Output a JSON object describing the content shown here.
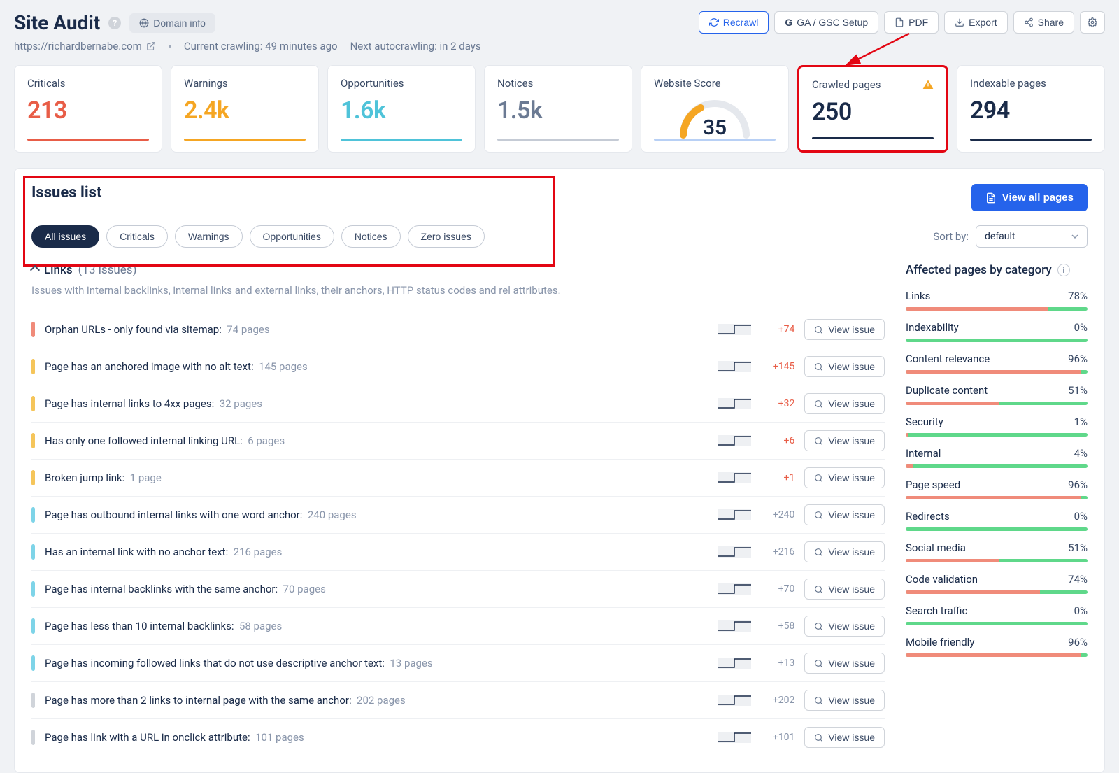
{
  "page_title": "Site Audit",
  "domain_info_btn": "Domain info",
  "header_buttons": {
    "recrawl": "Recrawl",
    "ga_gsc": "GA / GSC Setup",
    "pdf": "PDF",
    "export": "Export",
    "share": "Share"
  },
  "subheader": {
    "url": "https://richardbernabe.com",
    "crawl_status": "Current crawling: 49 minutes ago",
    "autocrawl": "Next autocrawling: in 2 days"
  },
  "stats": {
    "criticals": {
      "label": "Criticals",
      "value": "213"
    },
    "warnings": {
      "label": "Warnings",
      "value": "2.4k"
    },
    "opportunities": {
      "label": "Opportunities",
      "value": "1.6k"
    },
    "notices": {
      "label": "Notices",
      "value": "1.5k"
    },
    "website_score": {
      "label": "Website Score",
      "value": "35"
    },
    "crawled": {
      "label": "Crawled pages",
      "value": "250"
    },
    "indexable": {
      "label": "Indexable pages",
      "value": "294"
    }
  },
  "issues_title": "Issues list",
  "view_all_pages": "View all pages",
  "filters": [
    "All issues",
    "Criticals",
    "Warnings",
    "Opportunities",
    "Notices",
    "Zero issues"
  ],
  "sort_label": "Sort by:",
  "sort_value": "default",
  "section": {
    "name": "Links",
    "count": "(13 issues)",
    "desc": "Issues with internal backlinks, internal links and external links, their anchors, HTTP status codes and rel attributes."
  },
  "view_issue_label": "View issue",
  "issues": [
    {
      "sev": "critical",
      "name": "Orphan URLs - only found via sitemap:",
      "pages": "74 pages",
      "delta": "+74",
      "dcolor": "red"
    },
    {
      "sev": "warning",
      "name": "Page has an anchored image with no alt text:",
      "pages": "145 pages",
      "delta": "+145",
      "dcolor": "red"
    },
    {
      "sev": "warning",
      "name": "Page has internal links to 4xx pages:",
      "pages": "32 pages",
      "delta": "+32",
      "dcolor": "red"
    },
    {
      "sev": "warning",
      "name": "Has only one followed internal linking URL:",
      "pages": "6 pages",
      "delta": "+6",
      "dcolor": "red"
    },
    {
      "sev": "warning",
      "name": "Broken jump link:",
      "pages": "1 page",
      "delta": "+1",
      "dcolor": "red"
    },
    {
      "sev": "opportunity",
      "name": "Page has outbound internal links with one word anchor:",
      "pages": "240 pages",
      "delta": "+240",
      "dcolor": "gray"
    },
    {
      "sev": "opportunity",
      "name": "Has an internal link with no anchor text:",
      "pages": "216 pages",
      "delta": "+216",
      "dcolor": "gray"
    },
    {
      "sev": "opportunity",
      "name": "Page has internal backlinks with the same anchor:",
      "pages": "70 pages",
      "delta": "+70",
      "dcolor": "gray"
    },
    {
      "sev": "opportunity",
      "name": "Page has less than 10 internal backlinks:",
      "pages": "58 pages",
      "delta": "+58",
      "dcolor": "gray"
    },
    {
      "sev": "opportunity",
      "name": "Page has incoming followed links that do not use descriptive anchor text:",
      "pages": "13 pages",
      "delta": "+13",
      "dcolor": "gray"
    },
    {
      "sev": "notice",
      "name": "Page has more than 2 links to internal page with the same anchor:",
      "pages": "202 pages",
      "delta": "+202",
      "dcolor": "gray"
    },
    {
      "sev": "notice",
      "name": "Page has link with a URL in onclick attribute:",
      "pages": "101 pages",
      "delta": "+101",
      "dcolor": "gray"
    }
  ],
  "sidebar_title": "Affected pages by category",
  "categories": [
    {
      "name": "Links",
      "pct": "78%",
      "fill": 78
    },
    {
      "name": "Indexability",
      "pct": "0%",
      "fill": 0
    },
    {
      "name": "Content relevance",
      "pct": "96%",
      "fill": 96
    },
    {
      "name": "Duplicate content",
      "pct": "51%",
      "fill": 51
    },
    {
      "name": "Security",
      "pct": "1%",
      "fill": 1
    },
    {
      "name": "Internal",
      "pct": "4%",
      "fill": 4
    },
    {
      "name": "Page speed",
      "pct": "96%",
      "fill": 96
    },
    {
      "name": "Redirects",
      "pct": "0%",
      "fill": 0
    },
    {
      "name": "Social media",
      "pct": "51%",
      "fill": 51
    },
    {
      "name": "Code validation",
      "pct": "74%",
      "fill": 74
    },
    {
      "name": "Search traffic",
      "pct": "0%",
      "fill": 0
    },
    {
      "name": "Mobile friendly",
      "pct": "96%",
      "fill": 96
    }
  ]
}
